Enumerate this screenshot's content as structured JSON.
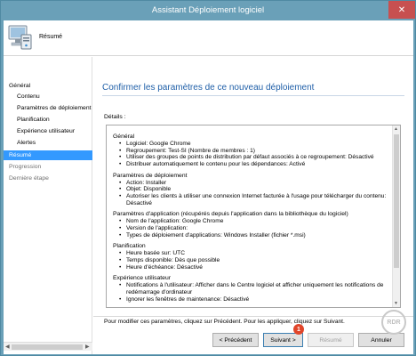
{
  "window": {
    "title": "Assistant Déploiement logiciel",
    "close_glyph": "✕"
  },
  "header": {
    "label": "Résumé",
    "icon": "computer-install-icon"
  },
  "nav": {
    "items": [
      {
        "label": "Général",
        "indent": false,
        "state": "normal"
      },
      {
        "label": "Contenu",
        "indent": true,
        "state": "normal"
      },
      {
        "label": "Paramètres de déploiement",
        "indent": true,
        "state": "normal"
      },
      {
        "label": "Planification",
        "indent": true,
        "state": "normal"
      },
      {
        "label": "Expérience utilisateur",
        "indent": true,
        "state": "normal"
      },
      {
        "label": "Alertes",
        "indent": true,
        "state": "normal"
      },
      {
        "label": "Résumé",
        "indent": false,
        "state": "active"
      },
      {
        "label": "Progression",
        "indent": false,
        "state": "gray"
      },
      {
        "label": "Dernière étape",
        "indent": false,
        "state": "gray"
      }
    ]
  },
  "main": {
    "title": "Confirmer les paramètres de ce nouveau déploiement",
    "details_label": "Détails :",
    "sections": [
      {
        "title": "Général",
        "items": [
          "Logiciel: Google Chrome",
          "Regroupement: Test-SI (Nombre de membres : 1)",
          "Utiliser des groupes de points de distribution par défaut associés à ce regroupement: Désactivé",
          "Distribuer automatiquement le contenu pour les dépendances: Activé"
        ]
      },
      {
        "title": "Paramètres de déploiement",
        "items": [
          "Action: Installer",
          "Objet: Disponible",
          "Autoriser les clients à utiliser une connexion Internet facturée à l'usage pour télécharger du contenu: Désactivé"
        ]
      },
      {
        "title": "Paramètres d'application (récupérés depuis l'application dans la bibliothèque du logiciel)",
        "items": [
          "Nom de l'application: Google Chrome",
          "Version de l'application:",
          "Types de déploiement d'applications: Windows Installer (fichier *.msi)"
        ]
      },
      {
        "title": "Planification",
        "items": [
          "Heure basée sur: UTC",
          "Temps disponible: Dès que possible",
          "Heure d'échéance: Désactivé"
        ]
      },
      {
        "title": "Expérience utilisateur",
        "items": [
          "Notifications à l'utilisateur: Afficher dans le Centre logiciel et afficher uniquement les notifications de redémarrage d'ordinateur",
          "Ignorer les fenêtres de maintenance: Désactivé"
        ]
      }
    ],
    "info_text": "Pour modifier ces paramètres, cliquez sur Précédent. Pour les appliquer, cliquez sur Suivant."
  },
  "buttons": {
    "previous": "< Précédent",
    "next": "Suivant >",
    "summary": "Résumé",
    "cancel": "Annuler"
  },
  "annotation": {
    "badge": "1",
    "watermark": "RDR"
  },
  "colors": {
    "title_bar": "#6aa0b8",
    "accent": "#1f5fa8",
    "nav_active": "#3399ff",
    "badge": "#e0452a"
  }
}
